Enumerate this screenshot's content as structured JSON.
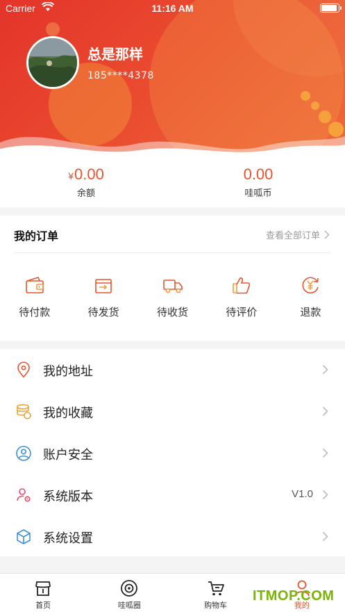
{
  "status_bar": {
    "carrier": "Carrier",
    "time": "11:16 AM"
  },
  "profile": {
    "username": "总是那样",
    "phone": "185****4378"
  },
  "balance": {
    "currency_symbol": "¥",
    "amount": "0.00",
    "amount_label": "余额",
    "coins": "0.00",
    "coins_label": "哇呱币"
  },
  "orders": {
    "title": "我的订单",
    "view_all": "查看全部订单",
    "items": [
      {
        "label": "待付款",
        "icon": "wallet-icon"
      },
      {
        "label": "待发货",
        "icon": "ship-box-icon"
      },
      {
        "label": "待收货",
        "icon": "truck-icon"
      },
      {
        "label": "待评价",
        "icon": "thumbs-up-icon"
      },
      {
        "label": "退款",
        "icon": "refund-icon"
      }
    ]
  },
  "menu": [
    {
      "label": "我的地址",
      "icon": "location-pin-icon",
      "value": ""
    },
    {
      "label": "我的收藏",
      "icon": "coins-icon",
      "value": ""
    },
    {
      "label": "账户安全",
      "icon": "user-circle-icon",
      "value": ""
    },
    {
      "label": "系统版本",
      "icon": "user-gear-icon",
      "value": "V1.0"
    },
    {
      "label": "系统设置",
      "icon": "cube-icon",
      "value": ""
    }
  ],
  "tabbar": [
    {
      "label": "首页",
      "icon": "store-icon",
      "active": false
    },
    {
      "label": "哇呱圈",
      "icon": "circle-target-icon",
      "active": false
    },
    {
      "label": "购物车",
      "icon": "cart-icon",
      "active": false
    },
    {
      "label": "我的",
      "icon": "person-icon",
      "active": true
    }
  ],
  "watermark": "ITMOP.COM",
  "colors": {
    "accent": "#e8532c",
    "header_start": "#e3342a",
    "header_end": "#ef6a3a"
  }
}
